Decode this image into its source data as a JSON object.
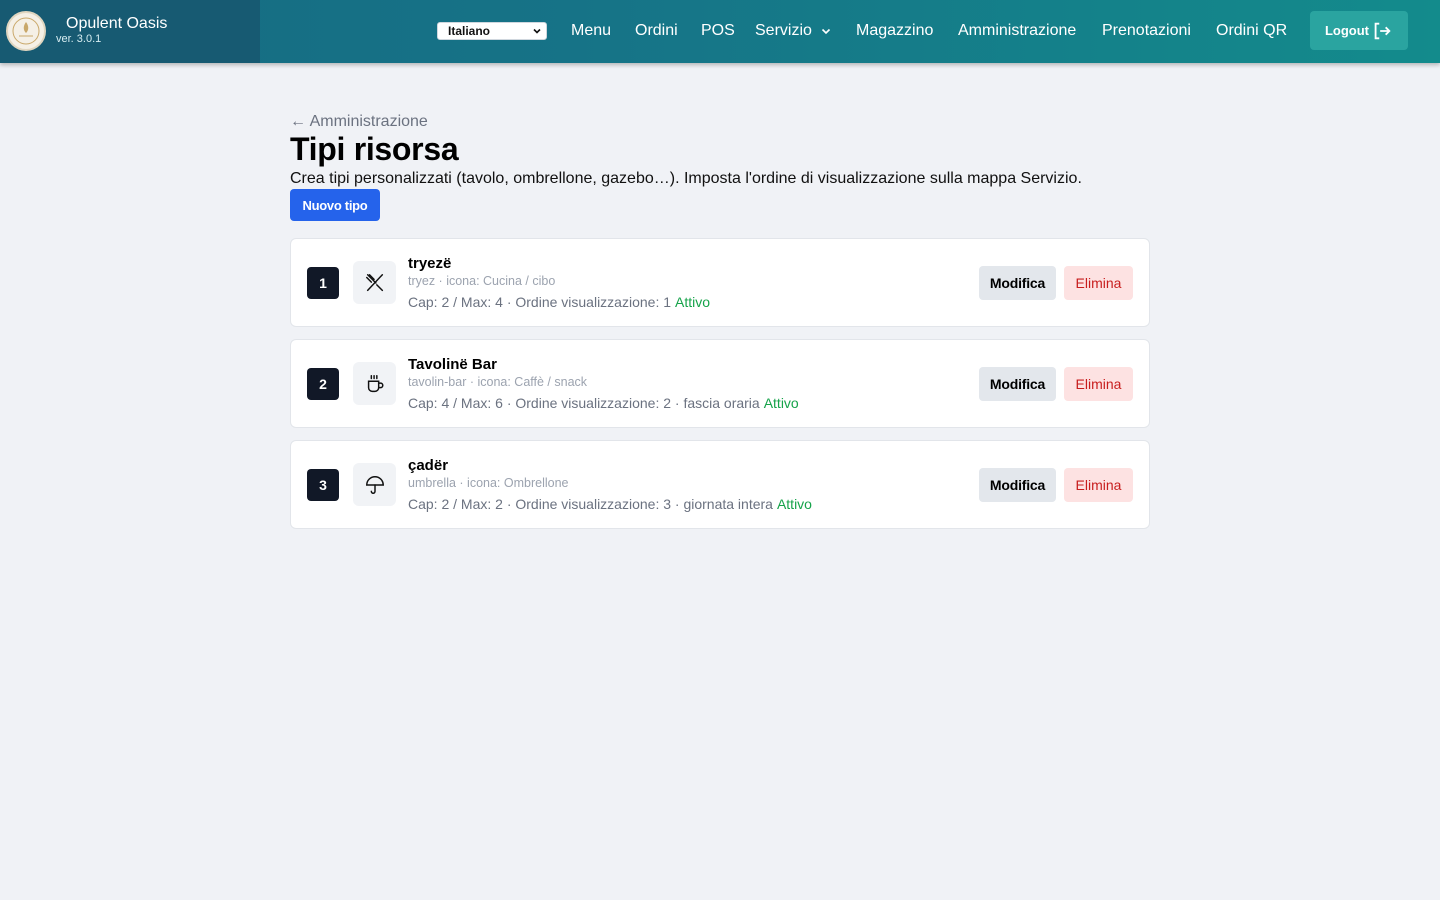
{
  "header": {
    "brand_name": "Opulent Oasis",
    "version": "ver. 3.0.1",
    "language": "Italiano",
    "nav": [
      {
        "label": "Menu"
      },
      {
        "label": "Ordini"
      },
      {
        "label": "POS"
      },
      {
        "label": "Servizio"
      },
      {
        "label": "Magazzino"
      },
      {
        "label": "Amministrazione"
      },
      {
        "label": "Prenotazioni"
      },
      {
        "label": "Ordini QR"
      }
    ],
    "logout": "Logout",
    "icons": {
      "logout": "logout-icon",
      "dropdown": "chevron-down-icon",
      "logo": "logo-icon"
    }
  },
  "page": {
    "back_link": "← Amministrazione",
    "title": "Tipi risorsa",
    "description": "Crea tipi personalizzati (tavolo, ombrellone, gazebo…). Imposta l'ordine di visualizzazione sulla mappa Servizio.",
    "new_button": "Nuovo tipo"
  },
  "types": [
    {
      "order": "1",
      "icon": "utensils-icon",
      "name": "tryezë",
      "meta": "tryez · icona: Cucina / cibo",
      "details": "Cap: 2 / Max: 4 · Ordine visualizzazione: 1",
      "status": "Attivo",
      "edit": "Modifica",
      "delete": "Elimina"
    },
    {
      "order": "2",
      "icon": "coffee-cup-icon",
      "name": "Tavolinë Bar",
      "meta": "tavolin-bar · icona: Caffè / snack",
      "details": "Cap: 4 / Max: 6 · Ordine visualizzazione: 2 · fascia oraria",
      "status": "Attivo",
      "edit": "Modifica",
      "delete": "Elimina"
    },
    {
      "order": "3",
      "icon": "umbrella-icon",
      "name": "çadër",
      "meta": "umbrella · icona: Ombrellone",
      "details": "Cap: 2 / Max: 2 · Ordine visualizzazione: 3 · giornata intera",
      "status": "Attivo",
      "edit": "Modifica",
      "delete": "Elimina"
    }
  ],
  "colors": {
    "header": "#167387",
    "primary": "#2563eb",
    "badge": "#111827",
    "active": "#16a34a",
    "danger": "#c81e1e"
  }
}
